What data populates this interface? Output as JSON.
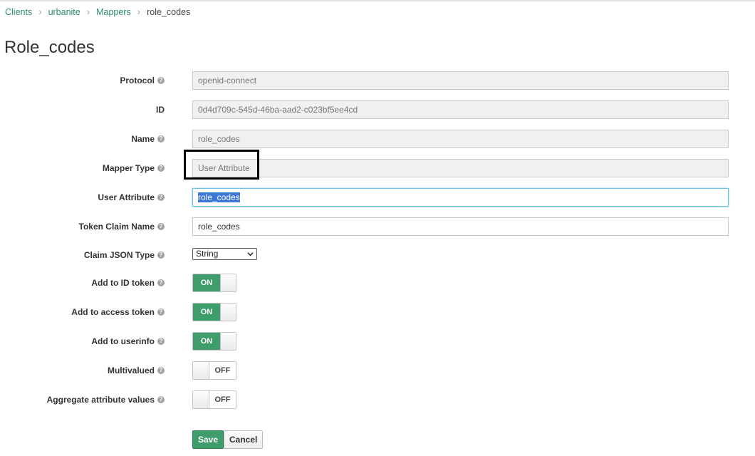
{
  "breadcrumb": {
    "items": [
      "Clients",
      "urbanite",
      "Mappers"
    ],
    "current": "role_codes"
  },
  "page_title": "Role_codes",
  "form": {
    "protocol": {
      "label": "Protocol",
      "value": "openid-connect"
    },
    "id": {
      "label": "ID",
      "value": "0d4d709c-545d-46ba-aad2-c023bf5ee4cd"
    },
    "name": {
      "label": "Name",
      "value": "role_codes"
    },
    "mapper_type": {
      "label": "Mapper Type",
      "value": "User Attribute"
    },
    "user_attribute": {
      "label": "User Attribute",
      "value": "role_codes"
    },
    "token_claim_name": {
      "label": "Token Claim Name",
      "value": "role_codes"
    },
    "claim_json_type": {
      "label": "Claim JSON Type",
      "value": "String"
    },
    "add_to_id_token": {
      "label": "Add to ID token",
      "state": "ON"
    },
    "add_to_access_token": {
      "label": "Add to access token",
      "state": "ON"
    },
    "add_to_userinfo": {
      "label": "Add to userinfo",
      "state": "ON"
    },
    "multivalued": {
      "label": "Multivalued",
      "state": "OFF"
    },
    "aggregate_attribute_values": {
      "label": "Aggregate attribute values",
      "state": "OFF"
    }
  },
  "help_glyph": "?",
  "buttons": {
    "save": "Save",
    "cancel": "Cancel"
  },
  "colors": {
    "link": "#2e8b6e",
    "primary": "#3f9c6b",
    "focus": "#66c2e0"
  }
}
